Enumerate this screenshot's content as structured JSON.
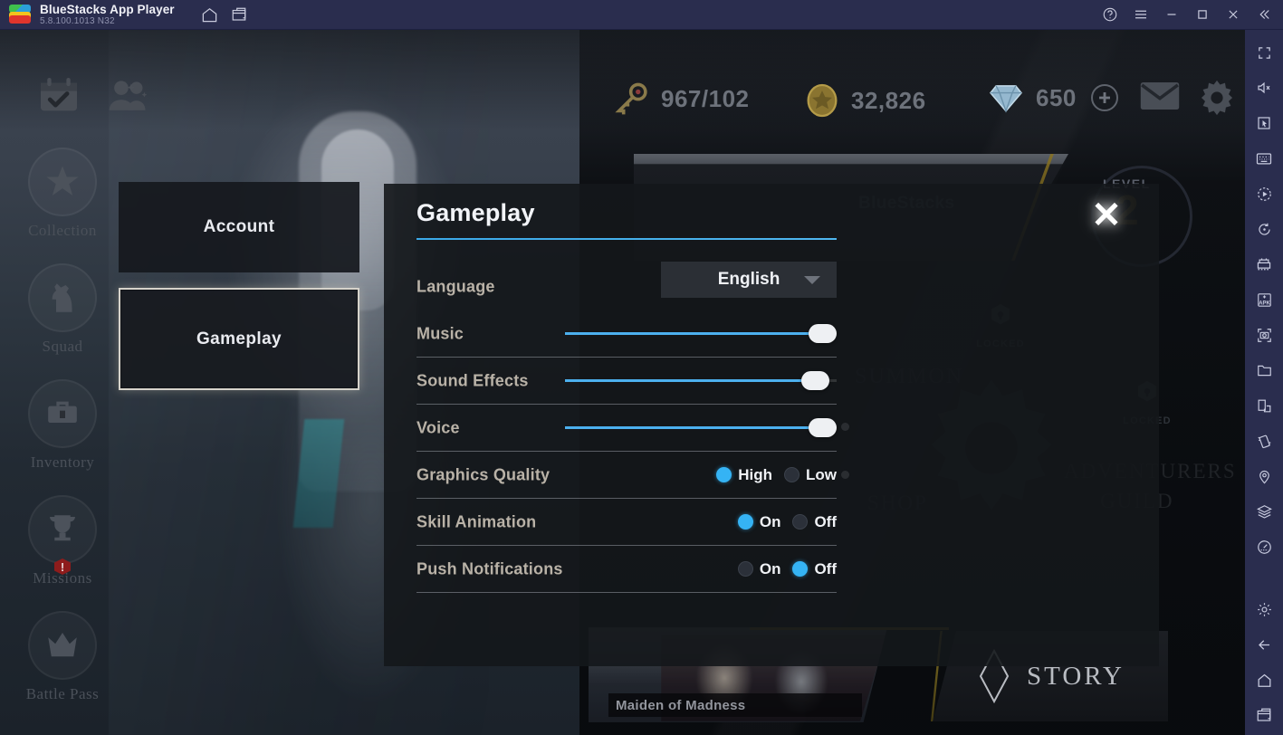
{
  "titlebar": {
    "logo_icon": "bluestacks-logo",
    "app_title": "BlueStacks App Player",
    "version": "5.8.100.1013  N32",
    "left_icons": [
      {
        "name": "home-icon"
      },
      {
        "name": "multi-instance-icon"
      }
    ],
    "right_icons": [
      {
        "name": "help-icon"
      },
      {
        "name": "menu-icon"
      },
      {
        "name": "minimize-icon"
      },
      {
        "name": "maximize-icon"
      },
      {
        "name": "close-icon"
      },
      {
        "name": "collapse-sidebar-icon"
      }
    ]
  },
  "game_topbar": {
    "checkin_icon": "calendar-check-icon",
    "friends_icon": "friends-icon",
    "mail_icon": "mail-icon",
    "settings_icon": "gear-icon",
    "currencies": [
      {
        "icon": "key-icon",
        "value": "967/102"
      },
      {
        "icon": "gold-coin-icon",
        "value": "32,826"
      },
      {
        "icon": "diamond-icon",
        "value": "650"
      }
    ],
    "add_gem_label": "+"
  },
  "left_nav": {
    "items": [
      {
        "label": "Collection",
        "icon": "star-emblem-icon",
        "badge": ""
      },
      {
        "label": "Squad",
        "icon": "knight-emblem-icon",
        "badge": ""
      },
      {
        "label": "Inventory",
        "icon": "bag-icon",
        "badge": ""
      },
      {
        "label": "Missions",
        "icon": "trophy-icon",
        "badge": "!"
      },
      {
        "label": "Battle Pass",
        "icon": "crown-icon",
        "badge": ""
      }
    ]
  },
  "background": {
    "player_name": "BlueStacks",
    "level_label": "LEVEL",
    "level_value": "2",
    "menu_words": {
      "summon": "SUMMON",
      "shop": "SHOP",
      "guild_line1": "ADVENTURERS",
      "guild_line2": "GUILD"
    },
    "locked_label": "LOCKED",
    "story_banner_title": "Maiden of Madness",
    "story_button_label": "STORY"
  },
  "settings": {
    "tabs": [
      {
        "id": "account",
        "label": "Account",
        "selected": false
      },
      {
        "id": "gameplay",
        "label": "Gameplay",
        "selected": true
      }
    ],
    "panel_title": "Gameplay",
    "close_label": "✕",
    "accent_color": "#4cb0ee",
    "rows": [
      {
        "id": "language",
        "label": "Language",
        "type": "dropdown",
        "value": "English",
        "caret_icon": "chevron-down-icon"
      },
      {
        "id": "music",
        "label": "Music",
        "type": "slider",
        "value": 100
      },
      {
        "id": "sound-effects",
        "label": "Sound Effects",
        "type": "slider",
        "value": 97
      },
      {
        "id": "voice",
        "label": "Voice",
        "type": "slider",
        "value": 100
      },
      {
        "id": "graphics-quality",
        "label": "Graphics Quality",
        "type": "radio",
        "options": [
          {
            "label": "High",
            "selected": true
          },
          {
            "label": "Low",
            "selected": false
          }
        ]
      },
      {
        "id": "skill-animation",
        "label": "Skill Animation",
        "type": "radio",
        "options": [
          {
            "label": "On",
            "selected": true
          },
          {
            "label": "Off",
            "selected": false
          }
        ]
      },
      {
        "id": "push-notifications",
        "label": "Push Notifications",
        "type": "radio",
        "options": [
          {
            "label": "On",
            "selected": false
          },
          {
            "label": "Off",
            "selected": true
          }
        ]
      }
    ]
  },
  "sidebar": {
    "items": [
      {
        "name": "fullscreen-icon"
      },
      {
        "name": "mute-icon"
      },
      {
        "name": "pointer-icon"
      },
      {
        "name": "keyboard-controls-icon"
      },
      {
        "name": "macro-recorder-icon"
      },
      {
        "name": "rotate-icon"
      },
      {
        "name": "multi-instance-manager-icon"
      },
      {
        "name": "install-apk-icon"
      },
      {
        "name": "screenshot-icon"
      },
      {
        "name": "media-folder-icon"
      },
      {
        "name": "resize-window-icon"
      },
      {
        "name": "shake-icon"
      },
      {
        "name": "location-icon"
      },
      {
        "name": "layers-icon"
      },
      {
        "name": "performance-icon"
      }
    ],
    "bottom_items": [
      {
        "name": "settings-gear-icon"
      },
      {
        "name": "back-icon"
      },
      {
        "name": "home-icon"
      },
      {
        "name": "recents-icon"
      }
    ]
  }
}
